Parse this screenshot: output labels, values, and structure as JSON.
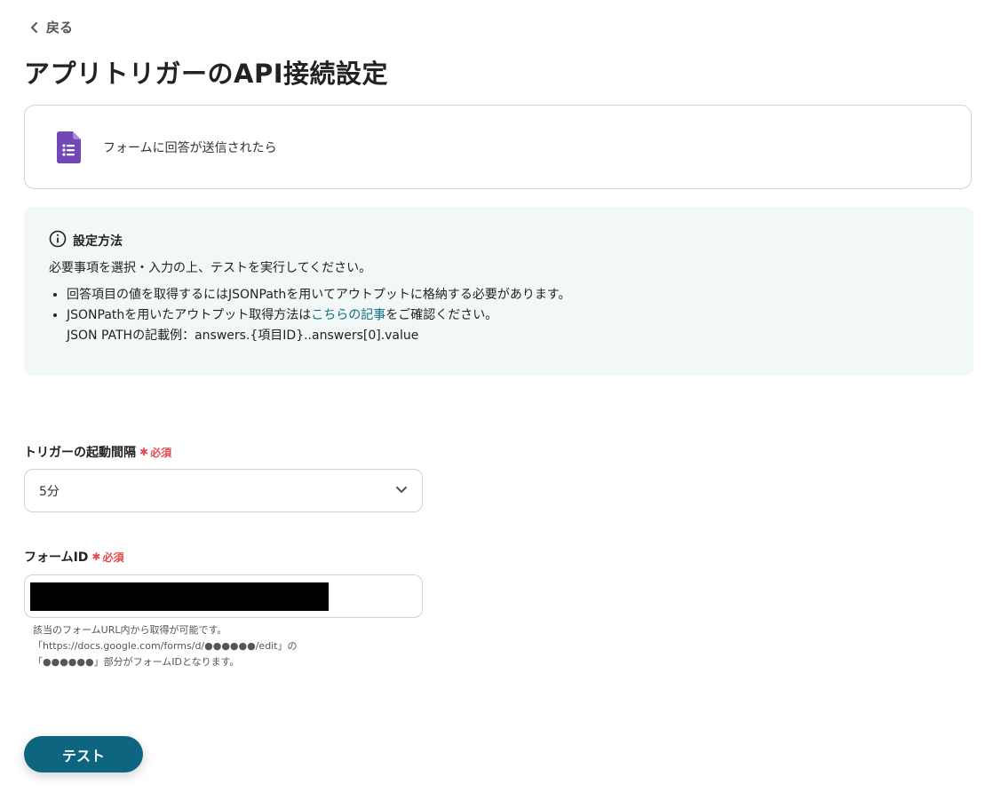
{
  "nav": {
    "back_label": "戻る"
  },
  "page": {
    "title": "アプリトリガーのAPI接続設定"
  },
  "trigger": {
    "label": "フォームに回答が送信されたら",
    "icon": "google-forms-icon"
  },
  "info": {
    "heading": "設定方法",
    "intro": "必要事項を選択・入力の上、テストを実行してください。",
    "bullet1": "回答項目の値を取得するにはJSONPathを用いてアウトプットに格納する必要があります。",
    "bullet2_before": "JSONPathを用いたアウトプット取得方法は",
    "bullet2_link": "こちらの記事",
    "bullet2_after": "をご確認ください。",
    "bullet2_line2": "JSON PATHの記載例：answers.{項目ID}..answers[0].value"
  },
  "interval_field": {
    "label": "トリガーの起動間隔",
    "required": "必須",
    "value": "5分"
  },
  "form_id_field": {
    "label": "フォームID",
    "required": "必須",
    "value": ""
  },
  "hint": {
    "line1": "該当のフォームURL内から取得が可能です。",
    "line2": "「https://docs.google.com/forms/d/●●●●●●/edit」の",
    "line3": "「●●●●●●」部分がフォームIDとなります。"
  },
  "actions": {
    "test_label": "テスト"
  },
  "colors": {
    "primary": "#0d6580",
    "link": "#0f6e86",
    "required": "#e5484d",
    "info_bg": "#f1f8f6",
    "forms_purple": "#7248b9"
  }
}
